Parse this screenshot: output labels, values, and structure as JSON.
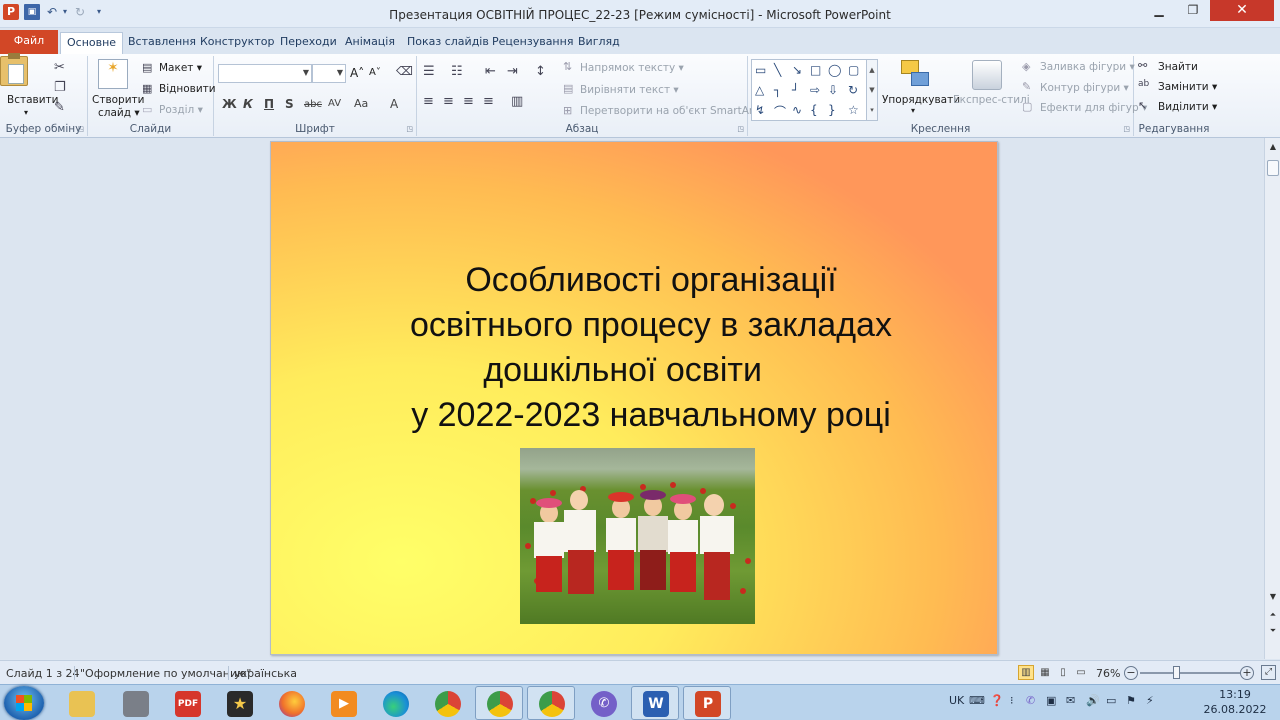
{
  "window": {
    "app_letter": "P",
    "title": "Презентация ОСВІТНІЙ ПРОЦЕС_22-23 [Режим сумісності] - Microsoft PowerPoint",
    "minimize": "▁",
    "maximize": "❐",
    "close": "✕"
  },
  "tabs": [
    "Файл",
    "Основне",
    "Вставлення",
    "Конструктор",
    "Переходи",
    "Анімація",
    "Показ слайдів",
    "Рецензування",
    "Вигляд"
  ],
  "help": {
    "minimize_ribbon": "⌃",
    "help": "?"
  },
  "ribbon": {
    "clipboard": {
      "label": "Буфер обміну",
      "paste": "Вставити"
    },
    "slides": {
      "label": "Слайди",
      "new_slide_1": "Створити",
      "new_slide_2": "слайд ▾",
      "layout": "Макет ▾",
      "reset": "Відновити",
      "section": "Розділ ▾"
    },
    "font": {
      "label": "Шрифт",
      "bold": "Ж",
      "italic": "К",
      "underline": "П",
      "shadow": "S",
      "strike": "abc",
      "spacing": "AV",
      "case": "Aa",
      "color": "A",
      "grow": "A˄",
      "shrink": "A˅"
    },
    "paragraph": {
      "label": "Абзац",
      "text_direction": "Напрямок тексту ▾",
      "align_text": "Вирівняти текст ▾",
      "smartart": "Перетворити на об'єкт SmartArt ▾"
    },
    "drawing": {
      "label": "Креслення",
      "arrange": "Упорядкувати",
      "quick_styles": "Експрес-стилі",
      "fill": "Заливка фігури ▾",
      "outline": "Контур фігури ▾",
      "effects": "Ефекти для фігур ▾"
    },
    "editing": {
      "label": "Редагування",
      "find": "Знайти",
      "replace": "Замінити ▾",
      "select": "Виділити ▾"
    }
  },
  "slide": {
    "title_lines": [
      "Особливості організації",
      "освітнього процесу в закладах",
      "дошкільної освіти      ",
      "у 2022-2023 навчальному році"
    ],
    "photo_desc": "children-in-poppy-field"
  },
  "status": {
    "slide_counter": "Слайд 1 з 24",
    "theme": "\"Оформление по умолчанию\"",
    "language": "українська",
    "zoom": "76%"
  },
  "taskbar": {
    "items": [
      {
        "name": "explorer",
        "label": "",
        "color": "#e9c253"
      },
      {
        "name": "printer",
        "label": "",
        "color": "#7a7f88"
      },
      {
        "name": "pdf",
        "label": "PDF",
        "color": "#d6362b"
      },
      {
        "name": "movie-star",
        "label": "★",
        "color": "#2a2a2a"
      },
      {
        "name": "firefox",
        "label": "",
        "color": "#f0712b"
      },
      {
        "name": "media-player",
        "label": "▶",
        "color": "#f28b20"
      },
      {
        "name": "edge",
        "label": "",
        "color": "#1a8fd6"
      },
      {
        "name": "chrome",
        "label": "",
        "color": "#3d9c4a"
      },
      {
        "name": "chrome-profile",
        "label": "",
        "color": "#3d9c4a"
      },
      {
        "name": "chrome-2",
        "label": "",
        "color": "#3d9c4a"
      },
      {
        "name": "viber",
        "label": "✆",
        "color": "#7460c8"
      },
      {
        "name": "word",
        "label": "W",
        "color": "#2b5fb1"
      },
      {
        "name": "powerpoint",
        "label": "P",
        "color": "#d24726"
      }
    ],
    "tray_lang": "UK",
    "time": "13:19",
    "date": "26.08.2022"
  },
  "colors": {
    "file_tab": "#d24726",
    "slide_gradient_light": "#ffff68",
    "slide_gradient_dark": "#ff975a"
  }
}
